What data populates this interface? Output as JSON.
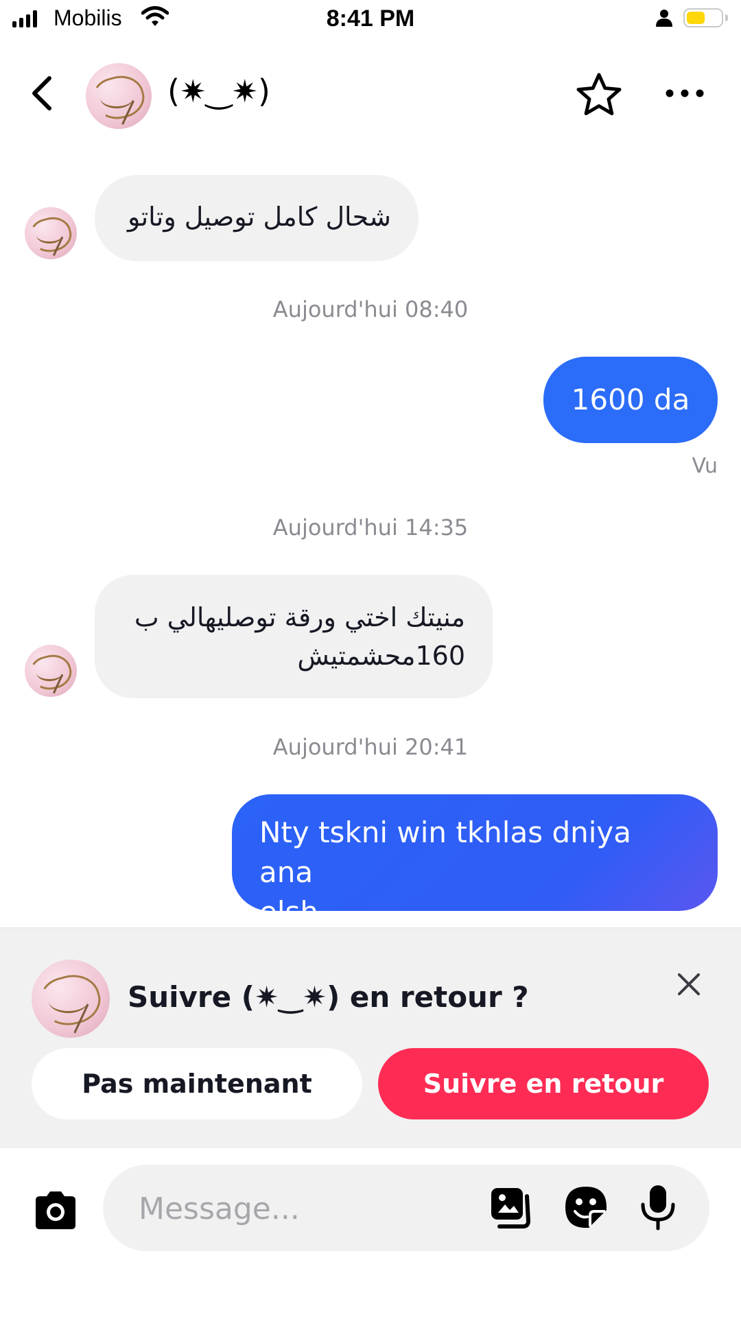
{
  "status_bar": {
    "carrier": "Mobilis",
    "time": "8:41 PM",
    "icons": [
      "signal-icon",
      "wifi-icon",
      "person-icon",
      "battery-icon"
    ]
  },
  "header": {
    "title": "(✷‿✷)",
    "icons": [
      "chevron-left-icon",
      "star-icon",
      "more-icon"
    ]
  },
  "messages": {
    "m1": "شحال كامل توصيل وتاتو",
    "ts1": "Aujourd'hui 08:40",
    "m2": "1600 da",
    "seen": "Vu",
    "ts2": "Aujourd'hui 14:35",
    "m3_line1": "منيتك اختي ورقة توصليهالي ب",
    "m3_line2": "160محشمتيش",
    "ts3": "Aujourd'hui 20:41",
    "m4_line1": "Nty tskni win tkhlas dniya ana",
    "m4_line2": "elsh"
  },
  "follow_prompt": {
    "text": "Suivre (✷‿✷) en retour ?",
    "not_now": "Pas maintenant",
    "follow_back": "Suivre en retour"
  },
  "composer": {
    "placeholder": "Message...",
    "icons": [
      "camera-icon",
      "gallery-icon",
      "sticker-icon",
      "microphone-icon"
    ]
  },
  "colors": {
    "outgoing_bubble": "#2b6cf8",
    "follow_button": "#fe2c55",
    "incoming_bubble": "#f1f1f2",
    "battery": "#ffd60a"
  }
}
